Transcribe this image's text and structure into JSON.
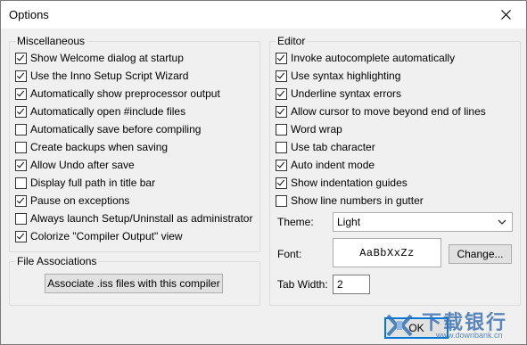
{
  "window": {
    "title": "Options"
  },
  "misc": {
    "legend": "Miscellaneous",
    "items": [
      {
        "label": "Show Welcome dialog at startup",
        "checked": true
      },
      {
        "label": "Use the Inno Setup Script Wizard",
        "checked": true
      },
      {
        "label": "Automatically show preprocessor output",
        "checked": true
      },
      {
        "label": "Automatically open #include files",
        "checked": true
      },
      {
        "label": "Automatically save before compiling",
        "checked": false
      },
      {
        "label": "Create backups when saving",
        "checked": false
      },
      {
        "label": "Allow Undo after save",
        "checked": true
      },
      {
        "label": "Display full path in title bar",
        "checked": false
      },
      {
        "label": "Pause on exceptions",
        "checked": true
      },
      {
        "label": "Always launch Setup/Uninstall as administrator",
        "checked": false
      },
      {
        "label": "Colorize \"Compiler Output\" view",
        "checked": true
      }
    ]
  },
  "file_assoc": {
    "legend": "File Associations",
    "button": "Associate .iss files with this compiler"
  },
  "editor": {
    "legend": "Editor",
    "items": [
      {
        "label": "Invoke autocomplete automatically",
        "checked": true
      },
      {
        "label": "Use syntax highlighting",
        "checked": true
      },
      {
        "label": "Underline syntax errors",
        "checked": true
      },
      {
        "label": "Allow cursor to move beyond end of lines",
        "checked": true
      },
      {
        "label": "Word wrap",
        "checked": false
      },
      {
        "label": "Use tab character",
        "checked": false
      },
      {
        "label": "Auto indent mode",
        "checked": true
      },
      {
        "label": "Show indentation guides",
        "checked": true
      },
      {
        "label": "Show line numbers in gutter",
        "checked": false
      }
    ],
    "theme_label": "Theme:",
    "theme_value": "Light",
    "font_label": "Font:",
    "font_sample": "AaBbXxZz",
    "change_button": "Change...",
    "tab_width_label": "Tab Width:",
    "tab_width_value": "2"
  },
  "buttons": {
    "ok": "OK"
  },
  "watermark": {
    "text": "下载银行",
    "url": "www.downbank.cn"
  }
}
